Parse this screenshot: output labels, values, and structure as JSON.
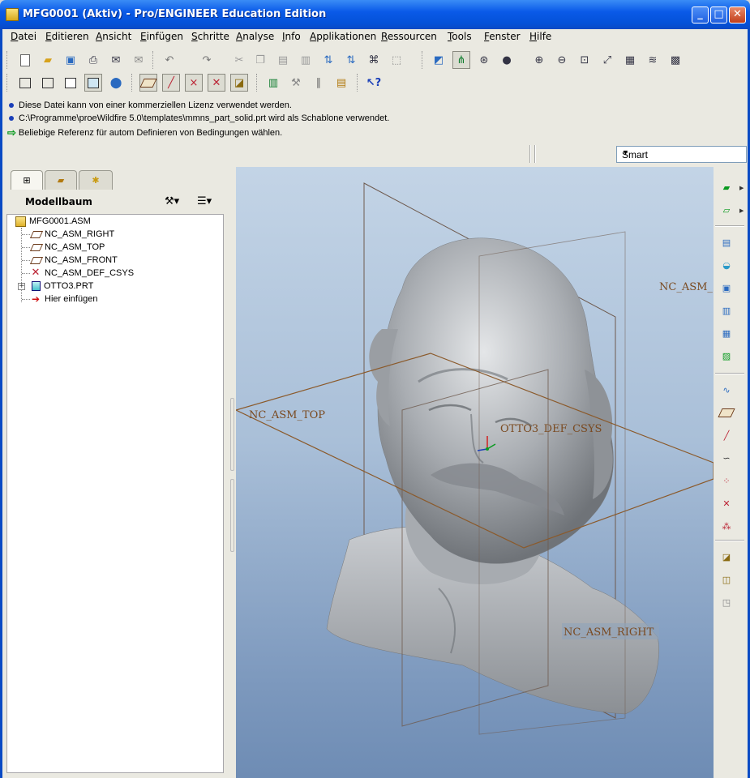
{
  "window": {
    "title": "MFG0001 (Aktiv) - Pro/ENGINEER Education Edition",
    "minimize_glyph": "_",
    "maximize_glyph": "□",
    "close_glyph": "✕"
  },
  "menu": [
    "Datei",
    "Editieren",
    "Ansicht",
    "Einfügen",
    "Schritte",
    "Analyse",
    "Info",
    "Applikationen",
    "Ressourcen",
    "Tools",
    "Fenster",
    "Hilfe"
  ],
  "messages": [
    "Diese Datei kann von einer kommerziellen Lizenz verwendet werden.",
    "C:\\Programme\\proeWildfire 5.0\\templates\\mmns_part_solid.prt wird als Schablone verwendet.",
    "Beliebige Referenz für autom Definieren von Bedingungen wählen."
  ],
  "filter": {
    "value": "Smart"
  },
  "model_tree": {
    "header": "Modellbaum",
    "nodes": [
      {
        "label": "MFG0001.ASM",
        "icon": "assembly-icon"
      },
      {
        "label": "NC_ASM_RIGHT",
        "icon": "datum-plane-icon"
      },
      {
        "label": "NC_ASM_TOP",
        "icon": "datum-plane-icon"
      },
      {
        "label": "NC_ASM_FRONT",
        "icon": "datum-plane-icon"
      },
      {
        "label": "NC_ASM_DEF_CSYS",
        "icon": "coordinate-system-icon"
      },
      {
        "label": "OTTO3.PRT",
        "icon": "part-icon"
      },
      {
        "label": "Hier einfügen",
        "icon": "insert-here-icon"
      }
    ]
  },
  "viewport": {
    "labels": {
      "front": "NC_ASM_",
      "top": "NC_ASM_TOP",
      "csys": "OTTO3_DEF_CSYS",
      "right": "NC_ASM_RIGHT"
    }
  }
}
